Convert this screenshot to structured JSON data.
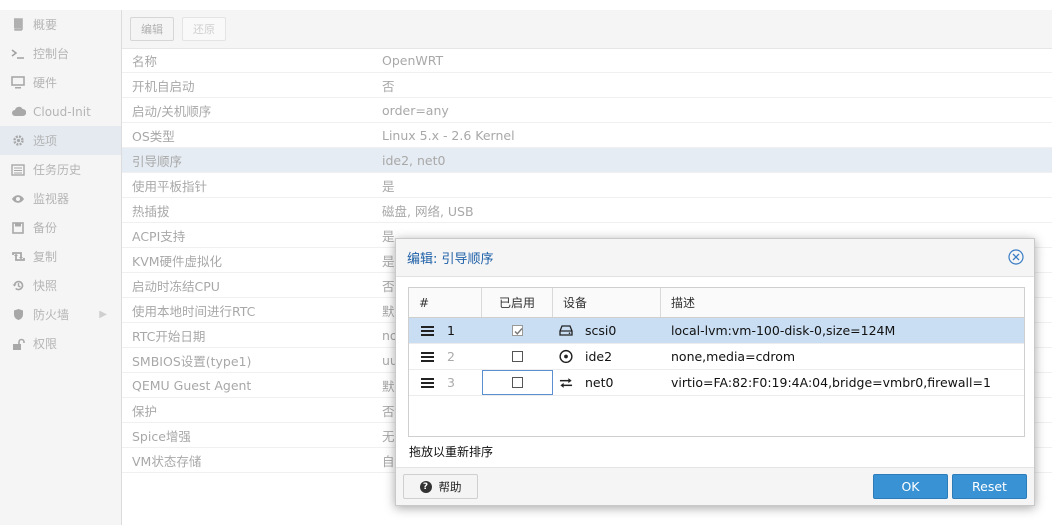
{
  "sidebar": {
    "items": [
      {
        "label": "概要",
        "icon": "book-icon"
      },
      {
        "label": "控制台",
        "icon": "terminal-icon"
      },
      {
        "label": "硬件",
        "icon": "monitor-icon"
      },
      {
        "label": "Cloud-Init",
        "icon": "cloud-icon"
      },
      {
        "label": "选项",
        "icon": "gear-icon",
        "selected": true
      },
      {
        "label": "任务历史",
        "icon": "list-icon"
      },
      {
        "label": "监视器",
        "icon": "eye-icon"
      },
      {
        "label": "备份",
        "icon": "floppy-icon"
      },
      {
        "label": "复制",
        "icon": "retweet-icon"
      },
      {
        "label": "快照",
        "icon": "history-icon"
      },
      {
        "label": "防火墙",
        "icon": "shield-icon",
        "has_arrow": true
      },
      {
        "label": "权限",
        "icon": "unlock-icon"
      }
    ]
  },
  "toolbar": {
    "edit_label": "编辑",
    "revert_label": "还原"
  },
  "options": {
    "rows": [
      {
        "key": "名称",
        "value": "OpenWRT"
      },
      {
        "key": "开机自启动",
        "value": "否"
      },
      {
        "key": "启动/关机顺序",
        "value": "order=any"
      },
      {
        "key": "OS类型",
        "value": "Linux 5.x - 2.6 Kernel"
      },
      {
        "key": "引导顺序",
        "value": "ide2, net0",
        "selected": true
      },
      {
        "key": "使用平板指针",
        "value": "是"
      },
      {
        "key": "热插拔",
        "value": "磁盘, 网络, USB"
      },
      {
        "key": "ACPI支持",
        "value": "是"
      },
      {
        "key": "KVM硬件虚拟化",
        "value": "是"
      },
      {
        "key": "启动时冻结CPU",
        "value": "否"
      },
      {
        "key": "使用本地时间进行RTC",
        "value": "默"
      },
      {
        "key": "RTC开始日期",
        "value": "no"
      },
      {
        "key": "SMBIOS设置(type1)",
        "value": "uu"
      },
      {
        "key": "QEMU Guest Agent",
        "value": "默"
      },
      {
        "key": "保护",
        "value": "否"
      },
      {
        "key": "Spice增强",
        "value": "无"
      },
      {
        "key": "VM状态存储",
        "value": "自"
      }
    ]
  },
  "dialog": {
    "title": "编辑: 引导顺序",
    "columns": {
      "num": "#",
      "enabled": "已启用",
      "device": "设备",
      "desc": "描述"
    },
    "rows": [
      {
        "num": "1",
        "enabled": true,
        "device": "scsi0",
        "device_icon": "hdd-icon",
        "desc": "local-lvm:vm-100-disk-0,size=124M",
        "selected": true
      },
      {
        "num": "2",
        "enabled": false,
        "device": "ide2",
        "device_icon": "cdrom-icon",
        "desc": "none,media=cdrom"
      },
      {
        "num": "3",
        "enabled": false,
        "device": "net0",
        "device_icon": "exchange-icon",
        "desc": "virtio=FA:82:F0:19:4A:04,bridge=vmbr0,firewall=1"
      }
    ],
    "hint": "拖放以重新排序",
    "help_label": "帮助",
    "ok_label": "OK",
    "reset_label": "Reset"
  }
}
